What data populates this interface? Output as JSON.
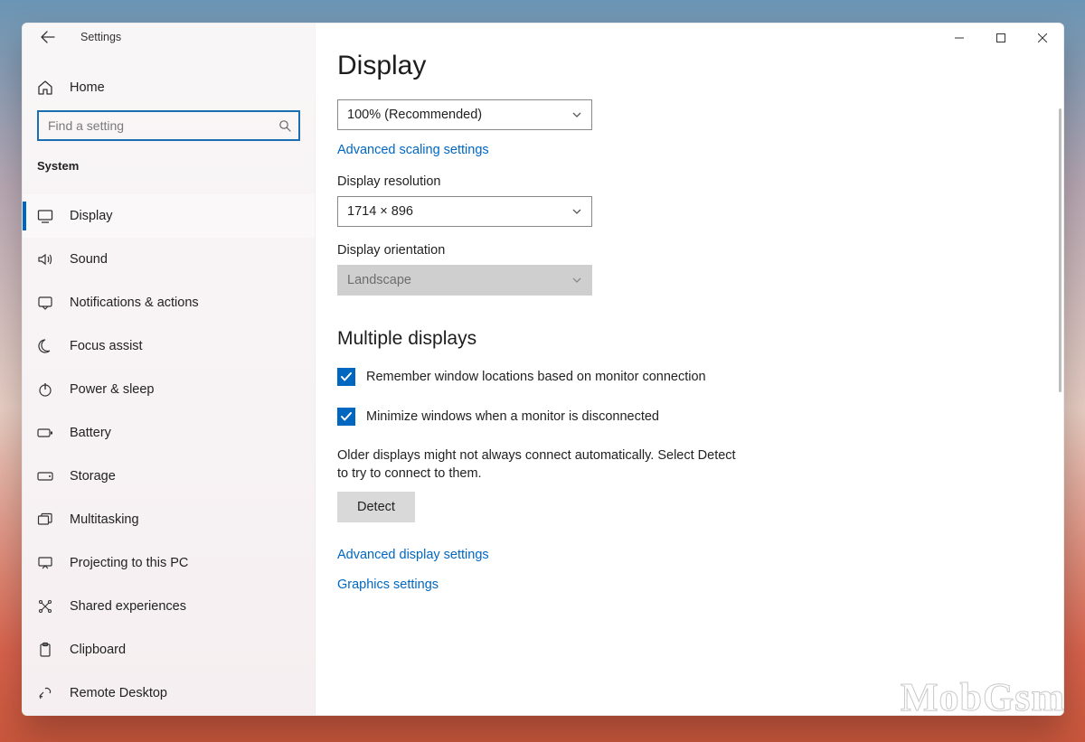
{
  "window": {
    "title": "Settings"
  },
  "sidebar": {
    "home_label": "Home",
    "search_placeholder": "Find a setting",
    "group_label": "System",
    "items": [
      {
        "label": "Display",
        "active": true
      },
      {
        "label": "Sound"
      },
      {
        "label": "Notifications & actions"
      },
      {
        "label": "Focus assist"
      },
      {
        "label": "Power & sleep"
      },
      {
        "label": "Battery"
      },
      {
        "label": "Storage"
      },
      {
        "label": "Multitasking"
      },
      {
        "label": "Projecting to this PC"
      },
      {
        "label": "Shared experiences"
      },
      {
        "label": "Clipboard"
      },
      {
        "label": "Remote Desktop"
      }
    ]
  },
  "main": {
    "page_title": "Display",
    "scale": {
      "value": "100% (Recommended)"
    },
    "scale_link": "Advanced scaling settings",
    "resolution": {
      "label": "Display resolution",
      "value": "1714 × 896"
    },
    "orientation": {
      "label": "Display orientation",
      "value": "Landscape"
    },
    "multi_title": "Multiple displays",
    "check1": "Remember window locations based on monitor connection",
    "check2": "Minimize windows when a monitor is disconnected",
    "helper": "Older displays might not always connect automatically. Select Detect to try to connect to them.",
    "detect_label": "Detect",
    "adv_display_link": "Advanced display settings",
    "graphics_link": "Graphics settings"
  },
  "watermark": "MobGsm"
}
